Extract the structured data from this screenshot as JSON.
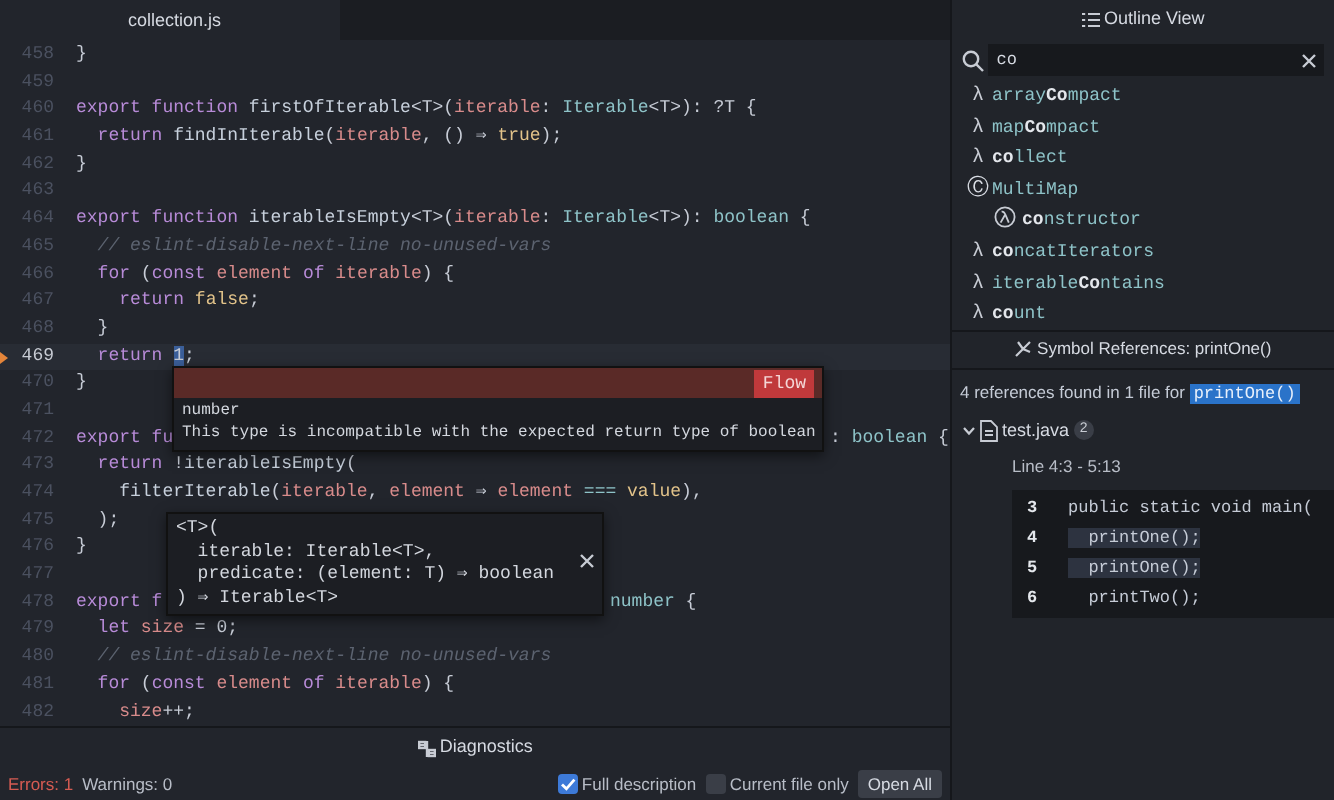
{
  "editor": {
    "tabs": [
      {
        "label": "collection.js",
        "selected": true
      }
    ],
    "lines": [
      {
        "number": "458",
        "error": false,
        "code": [
          {
            "kind": "plain",
            "text": "}"
          }
        ]
      },
      {
        "number": "459",
        "error": false
      },
      {
        "number": "460",
        "error": false,
        "code": [
          {
            "kind": "keyword",
            "text": "export function "
          },
          {
            "kind": "name",
            "text": "firstOfIterable"
          },
          {
            "kind": "plain",
            "text": "<T>("
          },
          {
            "kind": "variable",
            "text": "iterable"
          },
          {
            "kind": "plain",
            "text": ": "
          },
          {
            "kind": "type",
            "text": "Iterable"
          },
          {
            "kind": "plain",
            "text": "<T>): ?T {"
          }
        ]
      },
      {
        "number": "461",
        "error": false,
        "code": [
          {
            "kind": "keyword",
            "text": "  return "
          },
          {
            "kind": "name",
            "text": "findInIterable"
          },
          {
            "kind": "plain",
            "text": "("
          },
          {
            "kind": "variable",
            "text": "iterable"
          },
          {
            "kind": "plain",
            "text": ", () ⇒ "
          },
          {
            "kind": "constant",
            "text": "true"
          },
          {
            "kind": "plain",
            "text": ");"
          }
        ]
      },
      {
        "number": "462",
        "error": false,
        "code": [
          {
            "kind": "plain",
            "text": "}"
          }
        ]
      },
      {
        "number": "463",
        "error": false
      },
      {
        "number": "464",
        "error": false,
        "code": [
          {
            "kind": "keyword",
            "text": "export function "
          },
          {
            "kind": "name",
            "text": "iterableIsEmpty"
          },
          {
            "kind": "plain",
            "text": "<T>("
          },
          {
            "kind": "variable",
            "text": "iterable"
          },
          {
            "kind": "plain",
            "text": ": "
          },
          {
            "kind": "type",
            "text": "Iterable"
          },
          {
            "kind": "plain",
            "text": "<T>): "
          },
          {
            "kind": "type",
            "text": "boolean"
          },
          {
            "kind": "plain",
            "text": " {"
          }
        ]
      },
      {
        "number": "465",
        "error": false,
        "code": [
          {
            "kind": "comment",
            "text": "  // eslint-disable-next-line no-unused-vars"
          }
        ]
      },
      {
        "number": "466",
        "error": false,
        "code": [
          {
            "kind": "keyword",
            "text": "  for "
          },
          {
            "kind": "plain",
            "text": "("
          },
          {
            "kind": "keyword",
            "text": "const "
          },
          {
            "kind": "variable",
            "text": "element "
          },
          {
            "kind": "keyword",
            "text": "of "
          },
          {
            "kind": "variable",
            "text": "iterable"
          },
          {
            "kind": "plain",
            "text": ") {"
          }
        ]
      },
      {
        "number": "467",
        "error": false,
        "code": [
          {
            "kind": "keyword",
            "text": "    return "
          },
          {
            "kind": "constant",
            "text": "false"
          },
          {
            "kind": "plain",
            "text": ";"
          }
        ]
      },
      {
        "number": "468",
        "error": false,
        "code": [
          {
            "kind": "plain",
            "text": "  }"
          }
        ]
      },
      {
        "number": "469",
        "error": true,
        "code": [
          {
            "kind": "keyword",
            "text": "  return "
          },
          {
            "kind": "selection",
            "text": "1"
          },
          {
            "kind": "plain",
            "text": ";"
          }
        ]
      },
      {
        "number": "470",
        "error": false,
        "code": [
          {
            "kind": "plain",
            "text": "}"
          }
        ]
      },
      {
        "number": "471",
        "error": false
      },
      {
        "number": "472",
        "error": false,
        "code": [
          {
            "kind": "keyword",
            "text": "export fu"
          }
        ],
        "tail": [
          {
            "kind": "plain",
            "text": ": "
          },
          {
            "kind": "type",
            "text": "boolean"
          },
          {
            "kind": "plain",
            "text": " {"
          }
        ]
      },
      {
        "number": "473",
        "error": false,
        "code": [
          {
            "kind": "keyword",
            "text": "  return "
          },
          {
            "kind": "plain",
            "text": "!"
          },
          {
            "kind": "name",
            "text": "iterableIsEmpty"
          },
          {
            "kind": "plain",
            "text": "("
          }
        ]
      },
      {
        "number": "474",
        "error": false,
        "code": [
          {
            "kind": "name",
            "text": "    filterIterable"
          },
          {
            "kind": "plain",
            "text": "("
          },
          {
            "kind": "variable",
            "text": "iterable"
          },
          {
            "kind": "plain",
            "text": ", "
          },
          {
            "kind": "variable",
            "text": "element"
          },
          {
            "kind": "plain",
            "text": " ⇒ "
          },
          {
            "kind": "variable",
            "text": "element"
          },
          {
            "kind": "type",
            "text": " === "
          },
          {
            "kind": "constant",
            "text": "value"
          },
          {
            "kind": "plain",
            "text": "),"
          }
        ]
      },
      {
        "number": "475",
        "error": false,
        "code": [
          {
            "kind": "plain",
            "text": "  );"
          }
        ]
      },
      {
        "number": "476",
        "error": false,
        "code": [
          {
            "kind": "plain",
            "text": "}"
          }
        ]
      },
      {
        "number": "477",
        "error": false
      },
      {
        "number": "478",
        "error": false,
        "code": [
          {
            "kind": "keyword",
            "text": "export f"
          }
        ],
        "tail": [
          {
            "kind": "type",
            "text": "number"
          },
          {
            "kind": "plain",
            "text": " {"
          }
        ]
      },
      {
        "number": "479",
        "error": false,
        "code": [
          {
            "kind": "keyword",
            "text": "  let "
          },
          {
            "kind": "variable",
            "text": "size"
          },
          {
            "kind": "plain",
            "text": " = 0;"
          }
        ]
      },
      {
        "number": "480",
        "error": false,
        "code": [
          {
            "kind": "comment",
            "text": "  // eslint-disable-next-line no-unused-vars"
          }
        ]
      },
      {
        "number": "481",
        "error": false,
        "code": [
          {
            "kind": "keyword",
            "text": "  for "
          },
          {
            "kind": "plain",
            "text": "("
          },
          {
            "kind": "keyword",
            "text": "const "
          },
          {
            "kind": "variable",
            "text": "element "
          },
          {
            "kind": "keyword",
            "text": "of "
          },
          {
            "kind": "variable",
            "text": "iterable"
          },
          {
            "kind": "plain",
            "text": ") {"
          }
        ]
      },
      {
        "number": "482",
        "error": false,
        "code": [
          {
            "kind": "variable",
            "text": "    size"
          },
          {
            "kind": "plain",
            "text": "++;"
          }
        ]
      }
    ],
    "error_popup": {
      "badge": "Flow",
      "type": "number",
      "message": "This type is incompatible with the expected return type of boolean"
    },
    "signature_popup": {
      "lines": [
        "<T>(",
        "  iterable: Iterable<T>,",
        "  predicate: (element: T) ⇒ boolean",
        ") ⇒ Iterable<T>"
      ]
    }
  },
  "diagnostics": {
    "title": "Diagnostics",
    "errors": "Errors: 1",
    "warnings": "Warnings: 0",
    "options": [
      {
        "label": "Full description",
        "checked": true
      },
      {
        "label": "Current file only",
        "checked": false
      }
    ],
    "button": "Open All"
  },
  "outline": {
    "title": "Outline View",
    "search": {
      "value": "co"
    },
    "items": [
      {
        "kind": "function",
        "icon": "λ",
        "label": "array**Co**mpact"
      },
      {
        "kind": "function",
        "icon": "λ",
        "label": "map**Co**mpact"
      },
      {
        "kind": "function",
        "icon": "λ",
        "label": "**co**llect"
      },
      {
        "kind": "class",
        "icon": "Ⓒ",
        "label": "MultiMap",
        "children": [
          {
            "kind": "method",
            "label": "**co**nstructor"
          }
        ]
      },
      {
        "kind": "function",
        "icon": "λ",
        "label": "**co**ncatIterators"
      },
      {
        "kind": "function",
        "icon": "λ",
        "label": "iterable**Co**ntains"
      },
      {
        "kind": "function",
        "icon": "λ",
        "label": "**co**unt"
      }
    ]
  },
  "references": {
    "title": "Symbol References: printOne()",
    "summary": "4 references found in 1 file for",
    "symbol": "printOne()",
    "files": [
      {
        "name": "test.java",
        "count": "2",
        "expanded": true,
        "matches": [
          {
            "range": "Line 4:3 - 5:13",
            "snippet": [
              {
                "number": "3",
                "code": "public static void main(",
                "highlighted": false
              },
              {
                "number": "4",
                "code": "  printOne();",
                "highlighted": true
              },
              {
                "number": "5",
                "code": "  printOne();",
                "highlighted": true
              },
              {
                "number": "6",
                "code": "  printTwo();",
                "highlighted": false
              }
            ]
          }
        ]
      }
    ]
  }
}
